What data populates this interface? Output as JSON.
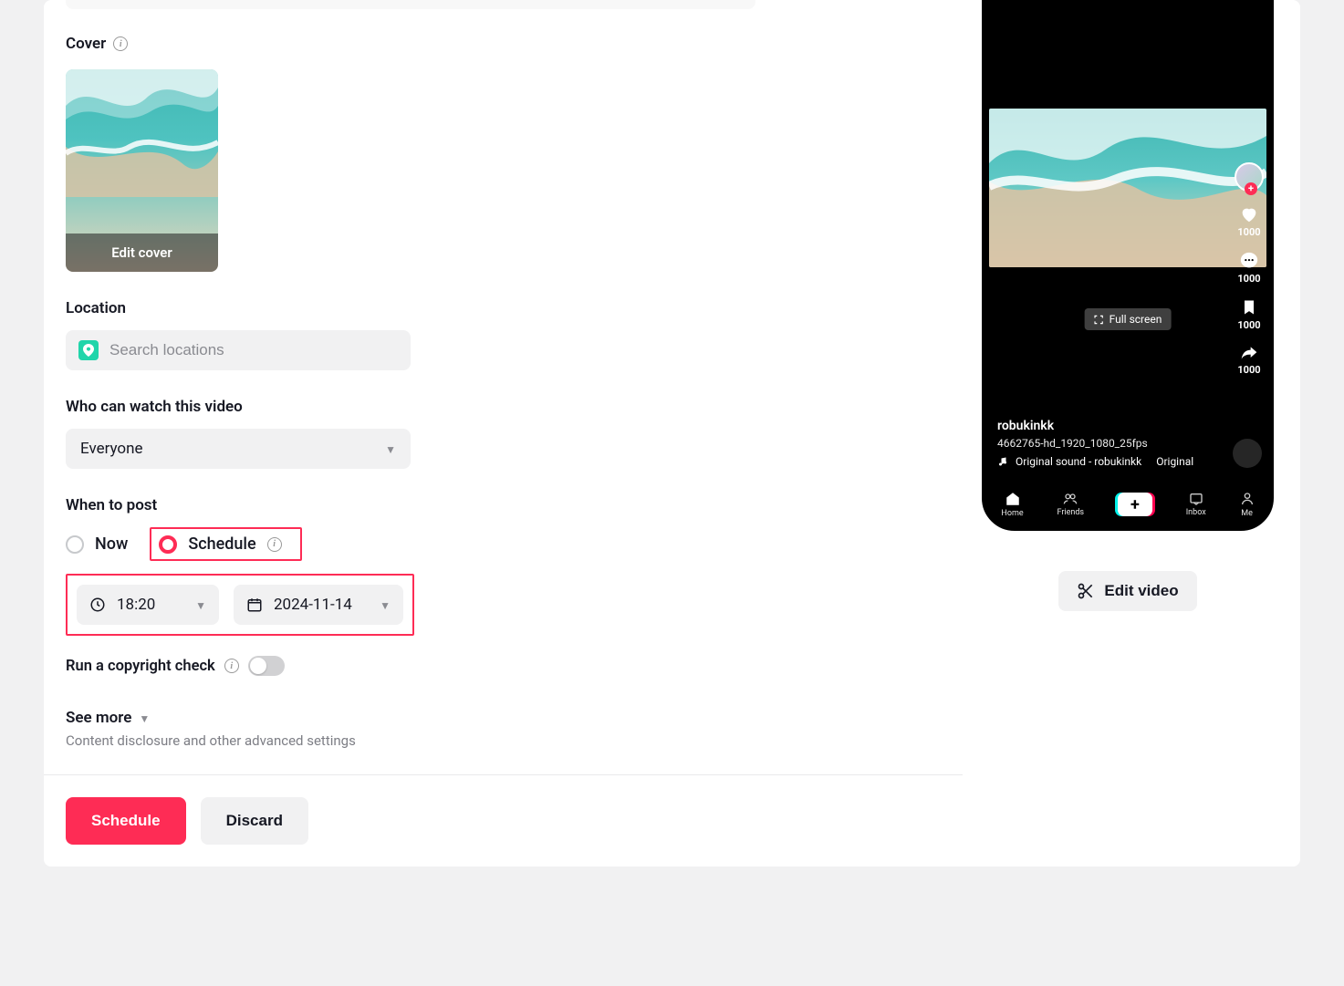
{
  "cover": {
    "label": "Cover",
    "edit_label": "Edit cover"
  },
  "location": {
    "label": "Location",
    "placeholder": "Search locations"
  },
  "privacy": {
    "label": "Who can watch this video",
    "selected": "Everyone"
  },
  "when": {
    "label": "When to post",
    "options": {
      "now": "Now",
      "schedule": "Schedule"
    },
    "selected": "schedule",
    "time": "18:20",
    "date": "2024-11-14"
  },
  "copyright": {
    "label": "Run a copyright check",
    "enabled": false
  },
  "more": {
    "label": "See more",
    "subtitle": "Content disclosure and other advanced settings"
  },
  "actions": {
    "primary": "Schedule",
    "discard": "Discard"
  },
  "preview": {
    "username": "robukinkk",
    "filename": "4662765-hd_1920_1080_25fps",
    "sound": "Original sound - robukinkk",
    "sound_tag": "Original",
    "fullscreen": "Full screen",
    "stats": {
      "like": "1000",
      "comment": "1000",
      "bookmark": "1000",
      "share": "1000"
    },
    "nav": {
      "home": "Home",
      "friends": "Friends",
      "inbox": "Inbox",
      "me": "Me"
    },
    "edit_button": "Edit video"
  }
}
